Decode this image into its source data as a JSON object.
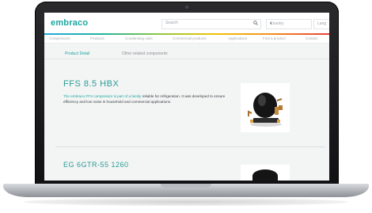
{
  "site": {
    "logo": "embraco",
    "search": {
      "placeholder": "Search"
    },
    "country_select": "Country",
    "language_select": "Lang",
    "nav": [
      "Compressors",
      "Products",
      "Condensing units",
      "Commercial products",
      "Applications",
      "Find a product",
      "Contact"
    ]
  },
  "tabs": {
    "active": "Product Detail",
    "inactive": "Other related components"
  },
  "product1": {
    "title": "FFS 8.5 HBX",
    "desc_highlight": "The embraco FFS compressor is part of a family",
    "desc_rest": " reliable for refrigeration. It was developed to ensure efficiency and low noise in household and commercial applications."
  },
  "product2": {
    "title": "EG 6GTR-55 1260"
  },
  "colors": {
    "brand": "#1aa7a1"
  }
}
